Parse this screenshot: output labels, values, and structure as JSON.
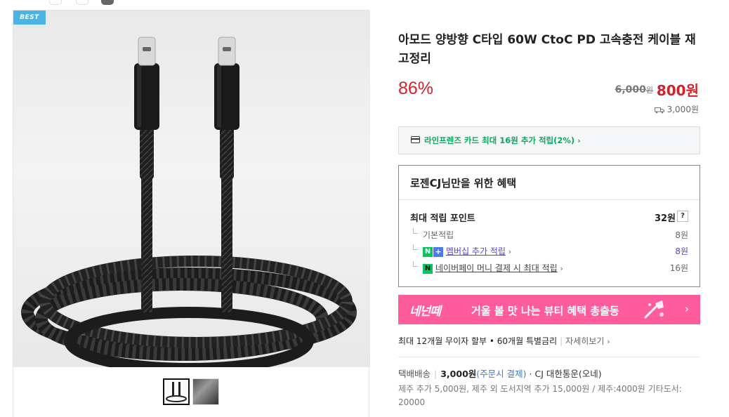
{
  "gallery": {
    "badge": "BEST",
    "thumbnails": [
      "thumb-1",
      "thumb-2"
    ]
  },
  "product": {
    "title": "아모드 양방향 C타입 60W CtoC PD 고속충전 케이블 재고정리",
    "discount": "86%",
    "original_price": "6,000",
    "original_unit": "원",
    "sale_price": "800원",
    "shipping_fee": "3,000원"
  },
  "card": {
    "text": "라인프렌즈 카드 최대 16원 추가 적립(2%)",
    "chevron": "›"
  },
  "benefits": {
    "title": "로젠CJ님만을 위한 혜택",
    "max_label": "최대 적립 포인트",
    "max_value": "32원",
    "help": "?",
    "basic_label": "기본적립",
    "basic_value": "8원",
    "membership_label": "멤버십 추가 적립",
    "membership_value": "8원",
    "npay_label": "네이버페이 머니 결제 시 최대 적립",
    "npay_value": "16원",
    "n_icon": "N",
    "plus_icon": "+",
    "npay_icon": "N"
  },
  "banner": {
    "brand": "네넌떼",
    "text": "거울 볼 맛 나는 뷰티 혜택 총출동",
    "arrow": "›"
  },
  "installment": {
    "text": "최대 12개월 무이자 할부 • 60개월 특별금리",
    "more": "자세히보기"
  },
  "delivery": {
    "label": "택배배송",
    "price": "3,000원",
    "payment": "(주문시 결제)",
    "dot": "·",
    "carrier": "CJ 대한통운(오네)",
    "extra": "제주 추가 5,000원, 제주 외 도서지역 추가 15,000원 / 제주:4000원 기타도서: 20000"
  },
  "colors": {
    "accent_red": "#d3222a",
    "naver_green": "#09aa5c",
    "banner_pink": "#ff5c9d",
    "badge_blue": "#4bb4e6",
    "membership_purple": "#5c3fcb"
  }
}
